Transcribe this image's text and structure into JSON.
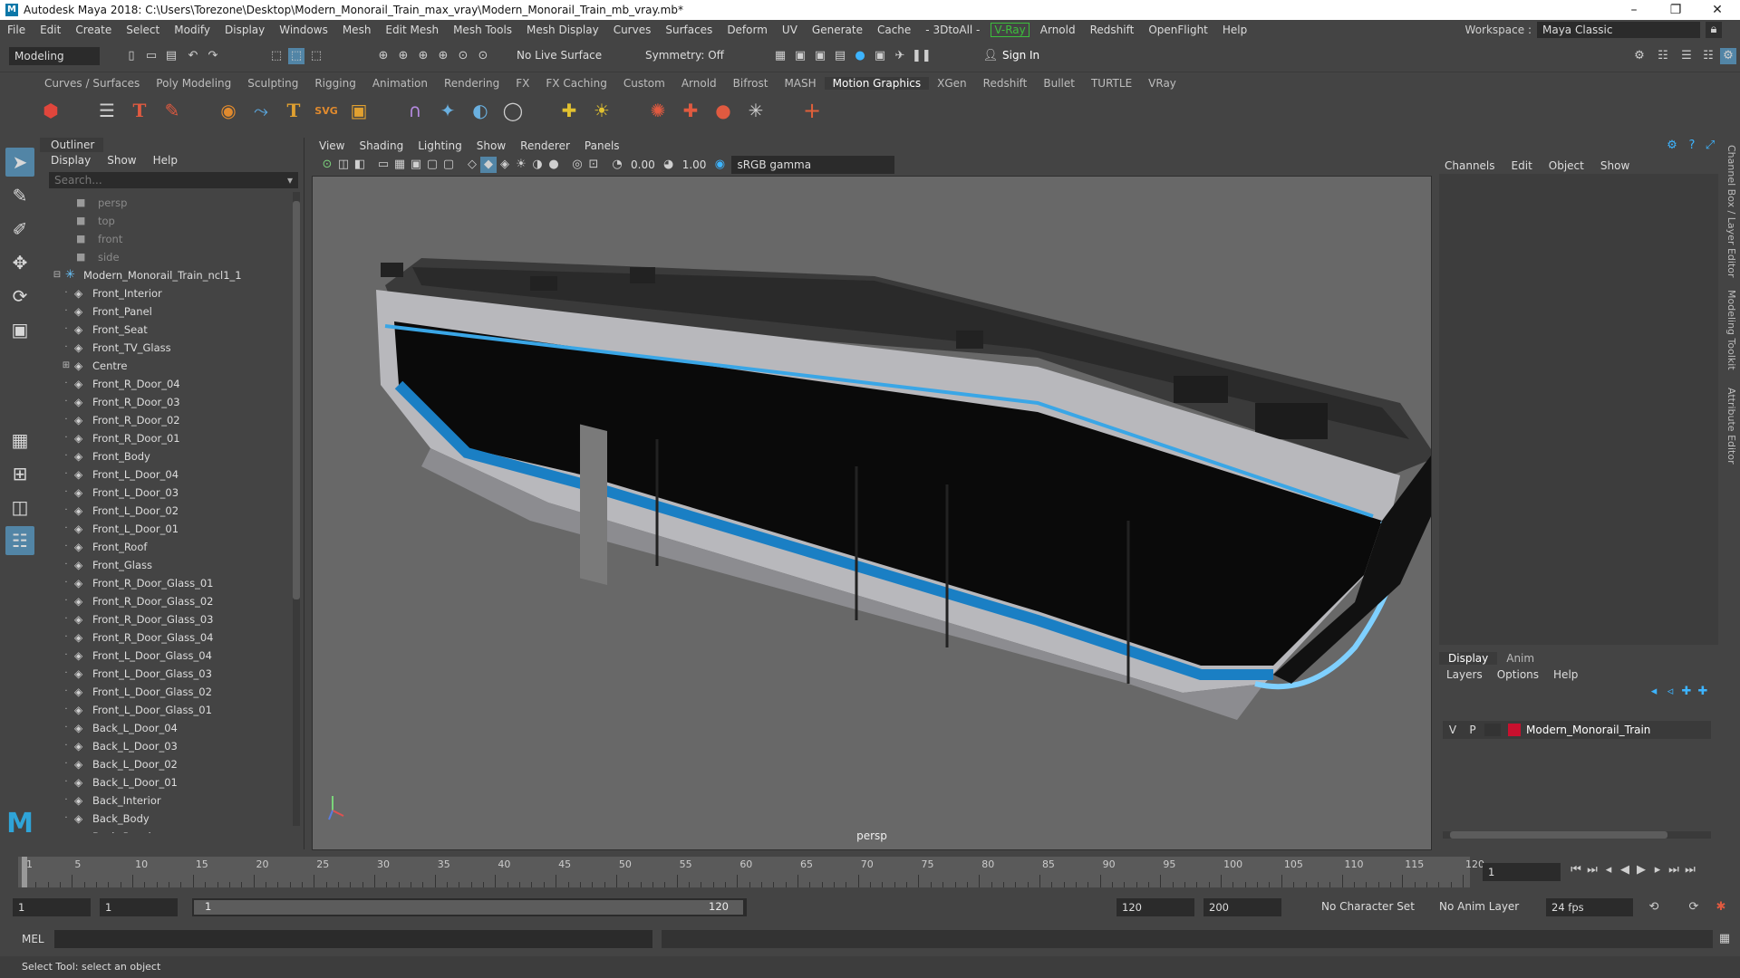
{
  "window": {
    "title": "Autodesk Maya 2018: C:\\Users\\Torezone\\Desktop\\Modern_Monorail_Train_max_vray\\Modern_Monorail_Train_mb_vray.mb*",
    "minimize": "–",
    "maximize": "❐",
    "close": "✕"
  },
  "menubar": {
    "items": [
      "File",
      "Edit",
      "Create",
      "Select",
      "Modify",
      "Display",
      "Windows",
      "Mesh",
      "Edit Mesh",
      "Mesh Tools",
      "Mesh Display",
      "Curves",
      "Surfaces",
      "Deform",
      "UV",
      "Generate",
      "Cache",
      "- 3DtoAll -"
    ],
    "vray": "V-Ray",
    "items2": [
      "Arnold",
      "Redshift",
      "OpenFlight",
      "Help"
    ],
    "workspace_label": "Workspace :",
    "workspace_value": "Maya Classic"
  },
  "statusline": {
    "mode": "Modeling",
    "live_surface": "No Live Surface",
    "symmetry": "Symmetry: Off",
    "sign_in": "Sign In"
  },
  "shelf": {
    "tabs": [
      "Curves / Surfaces",
      "Poly Modeling",
      "Sculpting",
      "Rigging",
      "Animation",
      "Rendering",
      "FX",
      "FX Caching",
      "Custom",
      "Arnold",
      "Bifrost",
      "MASH",
      "Motion Graphics",
      "XGen",
      "Redshift",
      "Bullet",
      "TURTLE",
      "VRay"
    ],
    "active_tab": "Motion Graphics"
  },
  "outliner": {
    "title": "Outliner",
    "menu": [
      "Display",
      "Show",
      "Help"
    ],
    "search_placeholder": "Search...",
    "cameras": [
      "persp",
      "top",
      "front",
      "side"
    ],
    "root": "Modern_Monorail_Train_ncl1_1",
    "items": [
      "Front_Interior",
      "Front_Panel",
      "Front_Seat",
      "Front_TV_Glass",
      "Centre",
      "Front_R_Door_04",
      "Front_R_Door_03",
      "Front_R_Door_02",
      "Front_R_Door_01",
      "Front_Body",
      "Front_L_Door_04",
      "Front_L_Door_03",
      "Front_L_Door_02",
      "Front_L_Door_01",
      "Front_Roof",
      "Front_Glass",
      "Front_R_Door_Glass_01",
      "Front_R_Door_Glass_02",
      "Front_R_Door_Glass_03",
      "Front_R_Door_Glass_04",
      "Front_L_Door_Glass_04",
      "Front_L_Door_Glass_03",
      "Front_L_Door_Glass_02",
      "Front_L_Door_Glass_01",
      "Back_L_Door_04",
      "Back_L_Door_03",
      "Back_L_Door_02",
      "Back_L_Door_01",
      "Back_Interior",
      "Back_Body",
      "Back_Panel"
    ]
  },
  "viewport": {
    "menu": [
      "View",
      "Shading",
      "Lighting",
      "Show",
      "Renderer",
      "Panels"
    ],
    "exposure": "0.00",
    "gamma": "1.00",
    "colorspace": "sRGB gamma",
    "camera": "persp"
  },
  "channelbox": {
    "menu": [
      "Channels",
      "Edit",
      "Object",
      "Show"
    ],
    "side_tabs": [
      "Channel Box / Layer Editor",
      "Modeling Toolkit",
      "Attribute Editor"
    ]
  },
  "layers": {
    "tabs": [
      "Display",
      "Anim"
    ],
    "menu": [
      "Layers",
      "Options",
      "Help"
    ],
    "v": "V",
    "p": "P",
    "layer_name": "Modern_Monorail_Train",
    "layer_color": "#c8102e"
  },
  "timeline": {
    "ticks": [
      "1",
      "5",
      "10",
      "15",
      "20",
      "25",
      "30",
      "35",
      "40",
      "45",
      "50",
      "55",
      "60",
      "65",
      "70",
      "75",
      "80",
      "85",
      "90",
      "95",
      "100",
      "105",
      "110",
      "115",
      "120"
    ],
    "current_frame": "1"
  },
  "range": {
    "start": "1",
    "playback_start": "1",
    "slider_start": "1",
    "slider_end": "120",
    "playback_end": "120",
    "end": "200",
    "character_set": "No Character Set",
    "anim_layer": "No Anim Layer",
    "fps": "24 fps"
  },
  "cmdline": {
    "label": "MEL"
  },
  "helpline": {
    "text": "Select Tool: select an object"
  }
}
